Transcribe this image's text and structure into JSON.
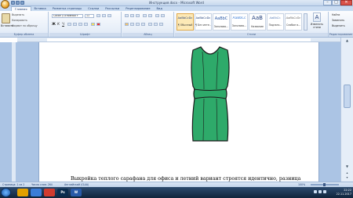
{
  "app": {
    "title": "Инструкция.docx - Microsoft Word"
  },
  "window_controls": {
    "minimize": "–",
    "maximize": "□",
    "close": "✕"
  },
  "tabs": [
    "Главная",
    "Вставка",
    "Разметка страницы",
    "Ссылки",
    "Рассылки",
    "Рецензирование",
    "Вид"
  ],
  "active_tab": 0,
  "clipboard": {
    "paste_label": "Вставить",
    "cut": "Вырезать",
    "copy": "Копировать",
    "format_painter": "Формат по образцу",
    "group_label": "Буфер обмена"
  },
  "font": {
    "name": "Calibri (Основной т",
    "size": "11",
    "group_label": "Шрифт",
    "bold": "Ж",
    "italic": "К",
    "underline": "Ч"
  },
  "paragraph": {
    "group_label": "Абзац"
  },
  "styles": {
    "group_label": "Стили",
    "items": [
      {
        "sample": "AaBbCcDc",
        "name": "¶ Обычный",
        "selected": true
      },
      {
        "sample": "AaBbCcDc",
        "name": "¶ Без инте...",
        "selected": false
      },
      {
        "sample": "AaBbC",
        "name": "Заголово...",
        "selected": false
      },
      {
        "sample": "AaBbCc",
        "name": "Заголово...",
        "selected": false
      },
      {
        "sample": "АаВ",
        "name": "Название",
        "selected": false
      },
      {
        "sample": "AaBbCc.",
        "name": "Подзаго...",
        "selected": false
      },
      {
        "sample": "AaBbCcDc",
        "name": "Слабое в...",
        "selected": false
      }
    ],
    "change_styles": "Изменить стили"
  },
  "editing": {
    "group_label": "Редактирование",
    "find": "Найти",
    "replace": "Заменить",
    "select": "Выделить"
  },
  "document": {
    "caption": "Выкройка теплого сарафана для офиса и летний вариант строятся идентично, разница",
    "dress_color": "#2eaa6a",
    "dress_outline": "#1a1a1a"
  },
  "statusbar": {
    "page": "Страница: 1 из 2",
    "words": "Число слов: 264",
    "language": "Английский (США)",
    "zoom": "100%"
  },
  "taskbar": {
    "apps": [
      {
        "label": "",
        "color": "#e2a000"
      },
      {
        "label": "",
        "color": "#3b7dd8"
      },
      {
        "label": "",
        "color": "#d13b2f"
      },
      {
        "label": "Ps",
        "color": "#0a2d4f"
      },
      {
        "label": "W",
        "color": "#2a5aa8"
      }
    ],
    "time": "22:22",
    "date": "22.11.2017"
  },
  "colors": {
    "ribbon_bg": "#dfe9f6",
    "accent": "#1e3c6e"
  }
}
